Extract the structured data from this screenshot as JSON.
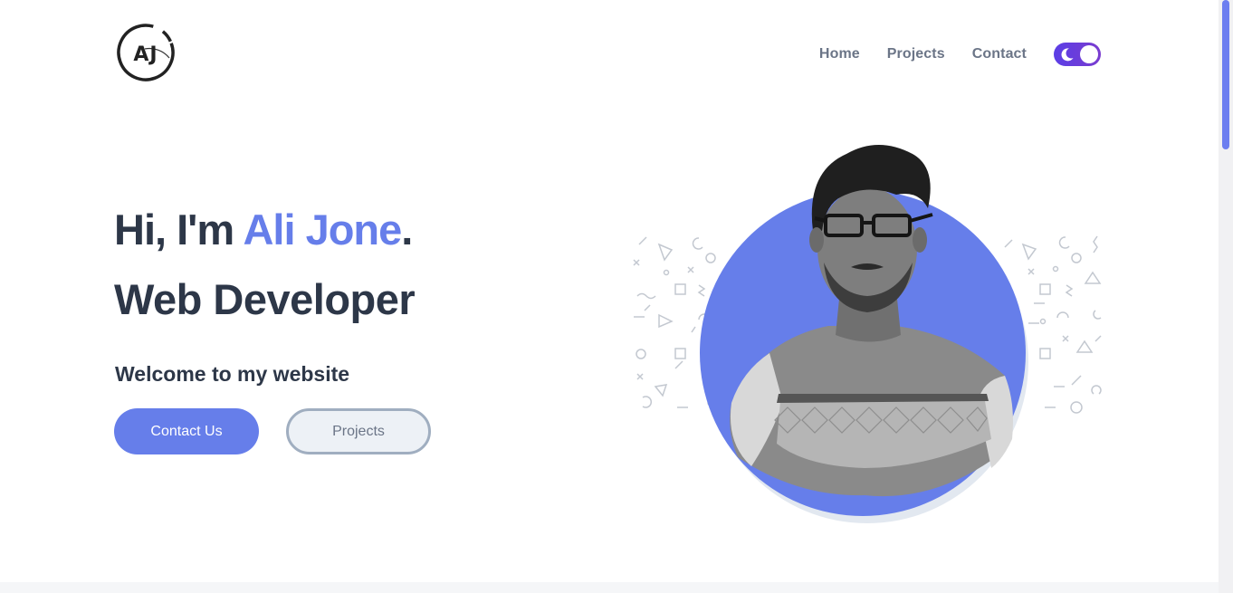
{
  "header": {
    "logo_text": "AJ",
    "nav": [
      {
        "label": "Home"
      },
      {
        "label": "Projects"
      },
      {
        "label": "Contact"
      }
    ],
    "theme_toggle": {
      "icon": "moon-icon",
      "state": "dark"
    }
  },
  "hero": {
    "greeting_prefix": "Hi, I'm ",
    "name": "Ali Jone",
    "greeting_suffix": ".",
    "role": "Web Developer",
    "welcome": "Welcome to my website",
    "primary_button": "Contact Us",
    "secondary_button": "Projects",
    "portrait": "profile-photo"
  },
  "colors": {
    "accent": "#667eea",
    "heading": "#2d3748",
    "nav_text": "#6b7587",
    "toggle_start": "#5b3ee6",
    "toggle_end": "#7a3ccf",
    "circle_shadow": "#e2e8f0"
  }
}
